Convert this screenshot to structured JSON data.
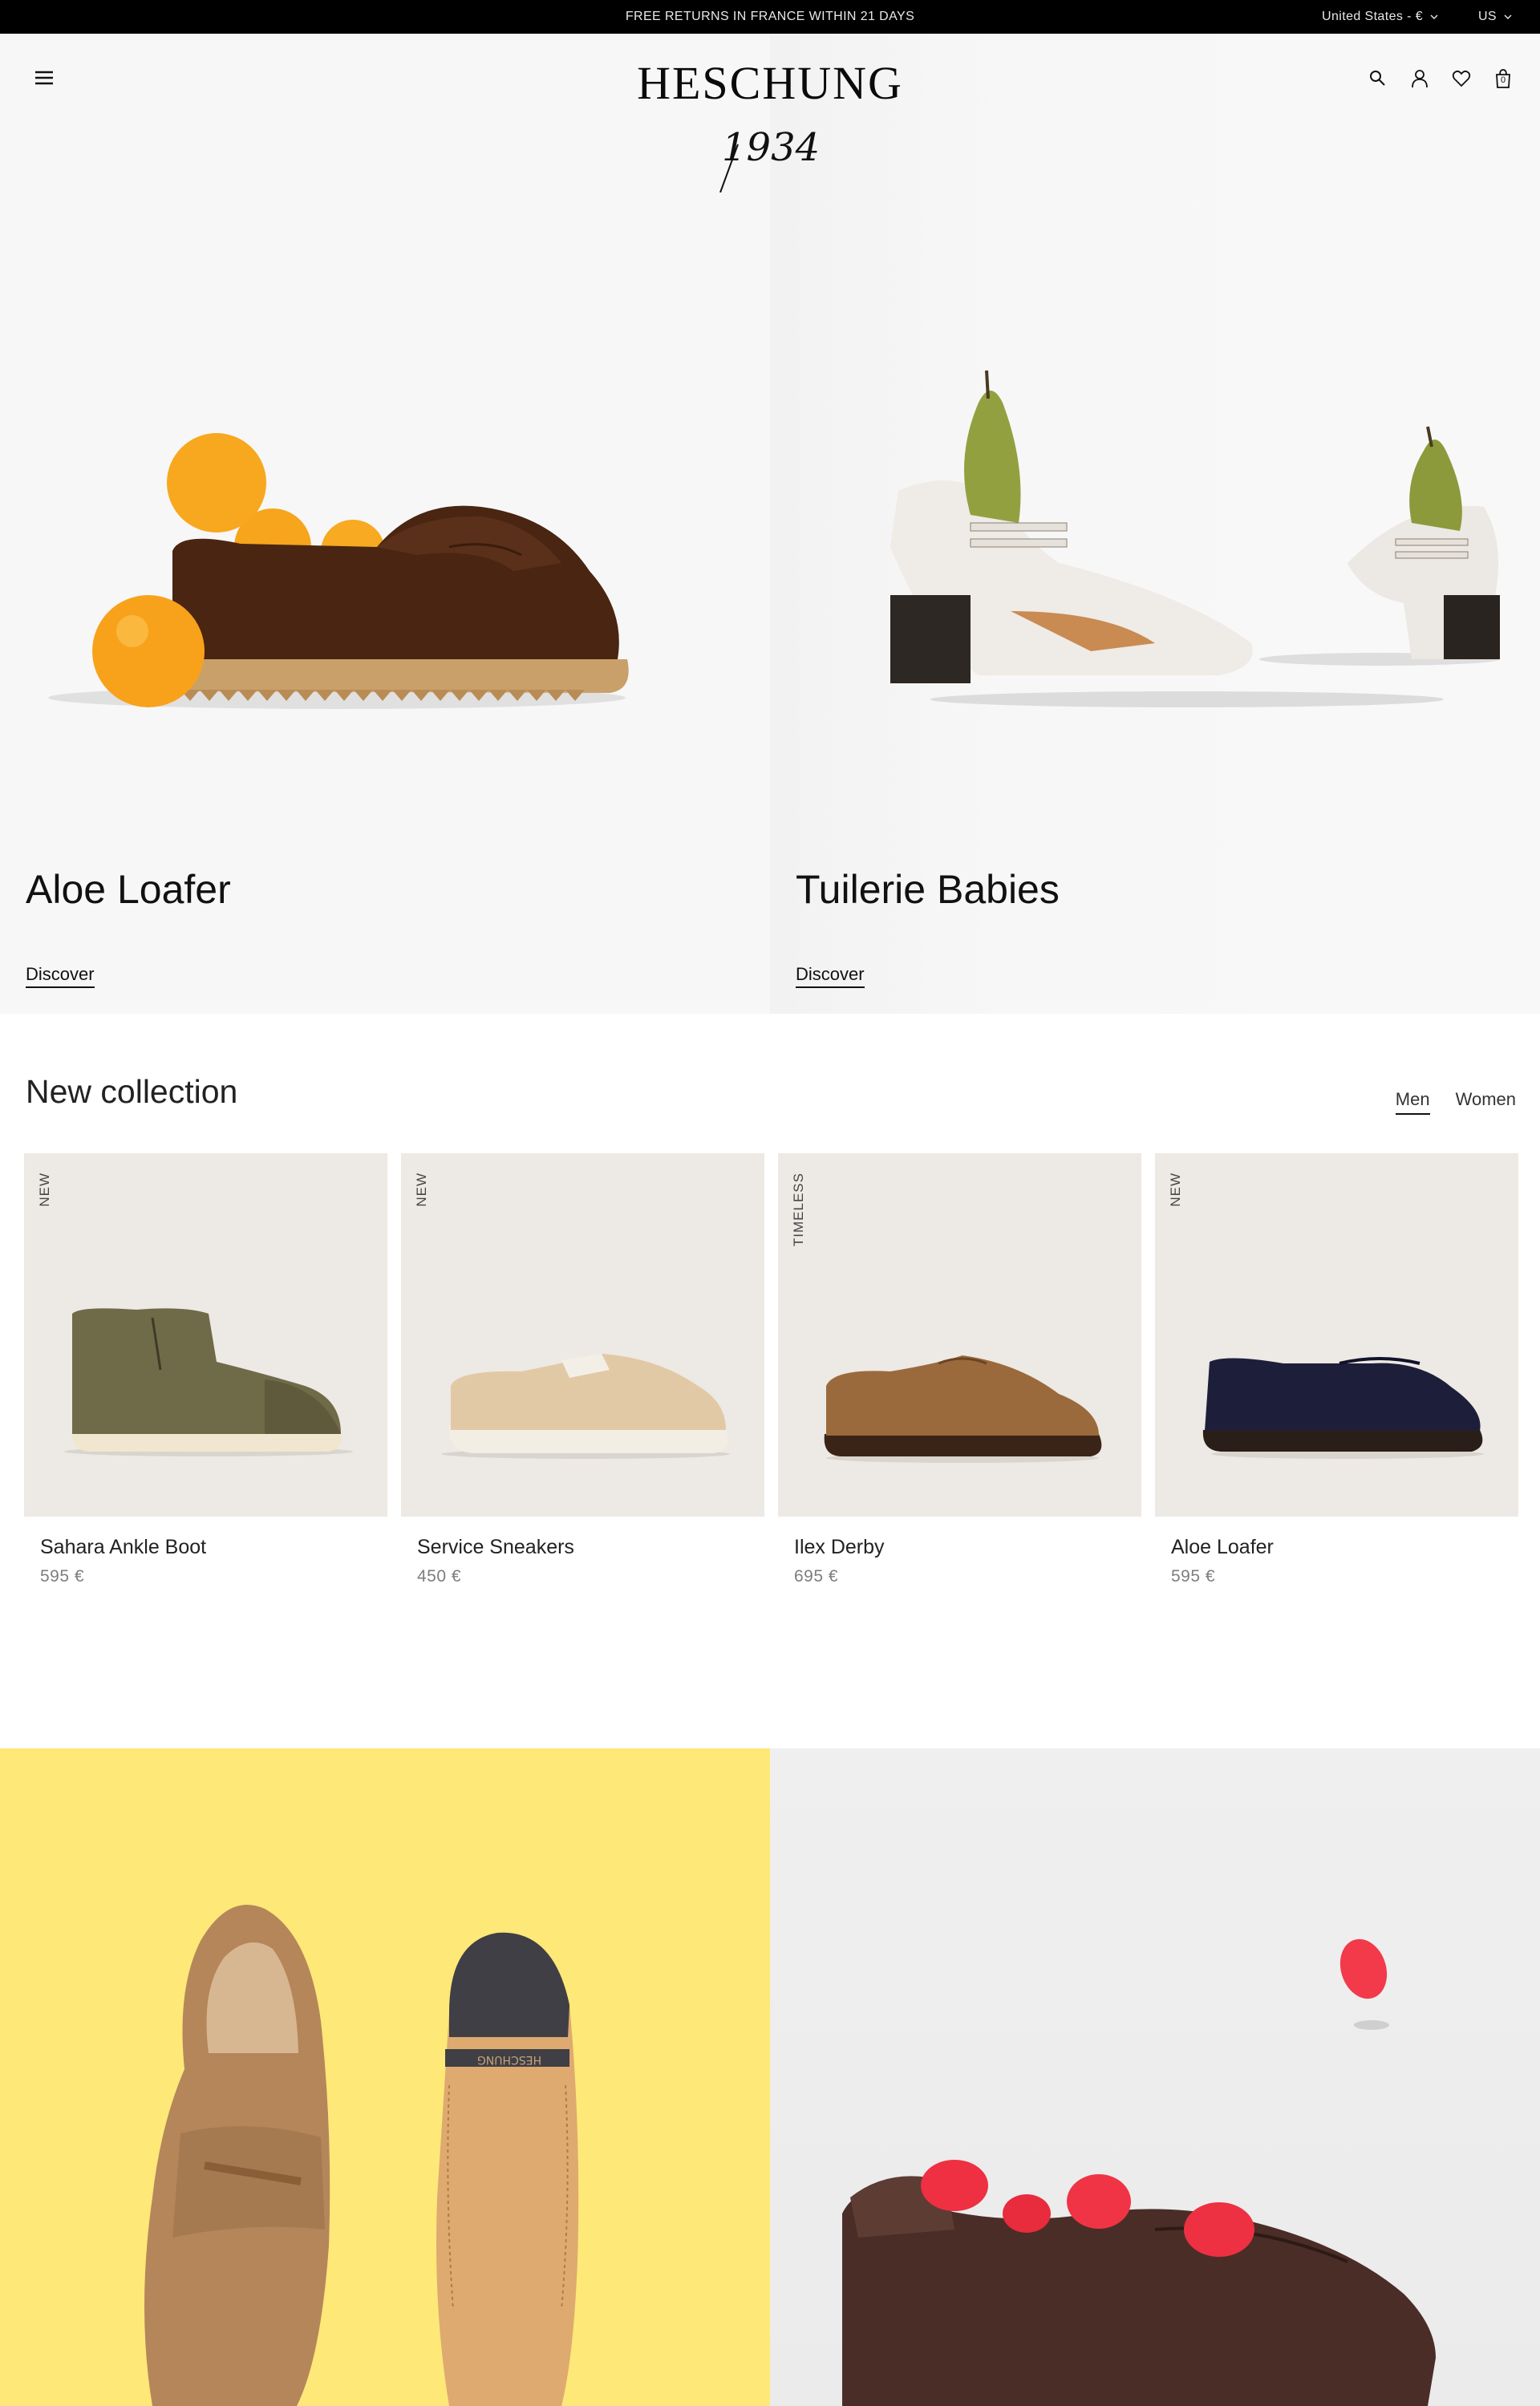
{
  "banner": {
    "message": "FREE RETURNS IN FRANCE WITHIN 21 DAYS",
    "region": "United States - €",
    "language": "US"
  },
  "header": {
    "logo_word": "HESCHUNG",
    "logo_year": "1934",
    "icons": [
      "menu-icon",
      "search-icon",
      "account-icon",
      "wishlist-icon",
      "cart-icon"
    ],
    "cart_count": "0"
  },
  "hero": [
    {
      "title": "Aloe Loafer",
      "link": "Discover"
    },
    {
      "title": "Tuilerie Babies",
      "link": "Discover"
    }
  ],
  "collection": {
    "title": "New collection",
    "tabs": [
      {
        "label": "Men",
        "active": true
      },
      {
        "label": "Women",
        "active": false
      }
    ],
    "products": [
      {
        "badge": "NEW",
        "name": "Sahara Ankle Boot",
        "price": "595 €"
      },
      {
        "badge": "NEW",
        "name": "Service Sneakers",
        "price": "450 €"
      },
      {
        "badge": "TIMELESS",
        "name": "Ilex Derby",
        "price": "695 €"
      },
      {
        "badge": "NEW",
        "name": "Aloe Loafer",
        "price": "595 €"
      }
    ]
  },
  "editorial": {
    "sole_lettering": "HESCHUNG"
  },
  "colors": {
    "banner_bg": "#000000",
    "hero_bg": "#f7f7f7",
    "product_bg": "#ede9e4",
    "editorial_yellow": "#fde878",
    "editorial_grey": "#ededed"
  }
}
